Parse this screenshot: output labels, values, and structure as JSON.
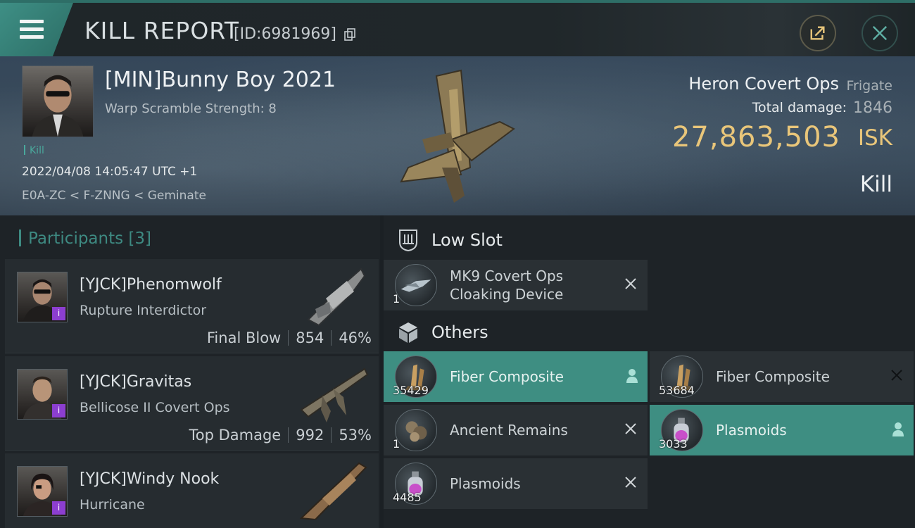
{
  "header": {
    "title": "KILL REPORT",
    "id_text": "[ID:6981969]"
  },
  "victim": {
    "name": "[MIN]Bunny Boy 2021",
    "warp_scramble": "Warp Scramble Strength: 8",
    "tag": "Kill",
    "datetime": "2022/04/08 14:05:47 UTC +1",
    "location": "E0A-ZC < F-ZNNG < Geminate",
    "ship_name": "Heron Covert Ops",
    "ship_class": "Frigate",
    "total_damage_label": "Total damage:",
    "total_damage": "1846",
    "isk_value": "27,863,503",
    "isk_unit": "ISK",
    "result": "Kill"
  },
  "participants": {
    "header": "Participants [3]",
    "items": [
      {
        "name": "[YJCK]Phenomwolf",
        "ship": "Rupture Interdictor",
        "role": "Final Blow",
        "damage": "854",
        "percent": "46%"
      },
      {
        "name": "[YJCK]Gravitas",
        "ship": "Bellicose II Covert Ops",
        "role": "Top Damage",
        "damage": "992",
        "percent": "53%"
      },
      {
        "name": "[YJCK]Windy Nook",
        "ship": "Hurricane",
        "role": "",
        "damage": "",
        "percent": ""
      }
    ]
  },
  "fitting": {
    "low_slot_label": "Low Slot",
    "others_label": "Others",
    "low_slot_items": [
      {
        "qty": "1",
        "name_line1": "MK9 Covert Ops",
        "name_line2": "Cloaking Device",
        "state": "destroyed"
      }
    ],
    "other_items": [
      {
        "qty": "35429",
        "name": "Fiber Composite",
        "state": "dropped"
      },
      {
        "qty": "53684",
        "name": "Fiber Composite",
        "state": "destroyed"
      },
      {
        "qty": "1",
        "name": "Ancient Remains",
        "state": "destroyed"
      },
      {
        "qty": "3033",
        "name": "Plasmoids",
        "state": "dropped"
      },
      {
        "qty": "4485",
        "name": "Plasmoids",
        "state": "destroyed"
      }
    ]
  },
  "colors": {
    "accent_teal": "#3e8e82",
    "isk_gold": "#e9c67a",
    "badge_purple": "#8c3ed0"
  }
}
